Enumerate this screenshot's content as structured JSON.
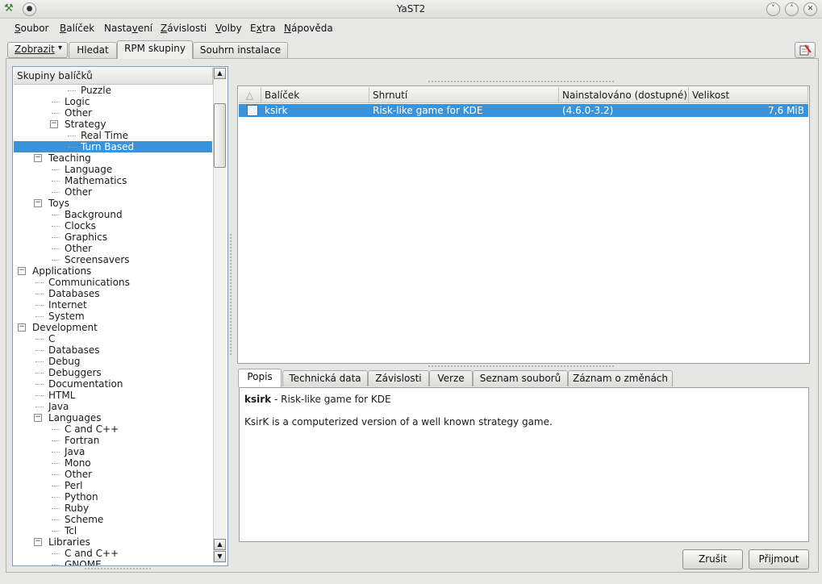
{
  "window": {
    "title": "YaST2",
    "controls": [
      "˅",
      "˄",
      "✕"
    ]
  },
  "menu": [
    {
      "pre": "",
      "u": "S",
      "post": "oubor"
    },
    {
      "pre": "",
      "u": "B",
      "post": "alíček"
    },
    {
      "pre": "Nasta",
      "u": "v",
      "post": "ení"
    },
    {
      "pre": "",
      "u": "Z",
      "post": "ávislosti"
    },
    {
      "pre": "",
      "u": "V",
      "post": "olby"
    },
    {
      "pre": "E",
      "u": "x",
      "post": "tra"
    },
    {
      "pre": "",
      "u": "N",
      "post": "ápověda"
    }
  ],
  "view_button": {
    "label": "Zobrazit",
    "arrow": "▾"
  },
  "tabs": [
    {
      "label": "Hledat"
    },
    {
      "label": "RPM skupiny"
    },
    {
      "label": "Souhrn instalace"
    }
  ],
  "tree": {
    "header": "Skupiny balíčků",
    "rows": [
      {
        "label": "Puzzle",
        "level": 4
      },
      {
        "label": "Logic",
        "level": 3
      },
      {
        "label": "Other",
        "level": 3
      },
      {
        "label": "Strategy",
        "level": 3,
        "expander": "−"
      },
      {
        "label": "Real Time",
        "level": 4
      },
      {
        "label": "Turn Based",
        "level": 4,
        "selected": true
      },
      {
        "label": "Teaching",
        "level": 2,
        "expander": "−"
      },
      {
        "label": "Language",
        "level": 3
      },
      {
        "label": "Mathematics",
        "level": 3
      },
      {
        "label": "Other",
        "level": 3
      },
      {
        "label": "Toys",
        "level": 2,
        "expander": "−"
      },
      {
        "label": "Background",
        "level": 3
      },
      {
        "label": "Clocks",
        "level": 3
      },
      {
        "label": "Graphics",
        "level": 3
      },
      {
        "label": "Other",
        "level": 3
      },
      {
        "label": "Screensavers",
        "level": 3
      },
      {
        "label": "Applications",
        "level": 1,
        "expander": "−"
      },
      {
        "label": "Communications",
        "level": 2
      },
      {
        "label": "Databases",
        "level": 2
      },
      {
        "label": "Internet",
        "level": 2
      },
      {
        "label": "System",
        "level": 2
      },
      {
        "label": "Development",
        "level": 1,
        "expander": "−"
      },
      {
        "label": "C",
        "level": 2
      },
      {
        "label": "Databases",
        "level": 2
      },
      {
        "label": "Debug",
        "level": 2
      },
      {
        "label": "Debuggers",
        "level": 2
      },
      {
        "label": "Documentation",
        "level": 2
      },
      {
        "label": "HTML",
        "level": 2
      },
      {
        "label": "Java",
        "level": 2
      },
      {
        "label": "Languages",
        "level": 2,
        "expander": "−"
      },
      {
        "label": "C and C++",
        "level": 3
      },
      {
        "label": "Fortran",
        "level": 3
      },
      {
        "label": "Java",
        "level": 3
      },
      {
        "label": "Mono",
        "level": 3
      },
      {
        "label": "Other",
        "level": 3
      },
      {
        "label": "Perl",
        "level": 3
      },
      {
        "label": "Python",
        "level": 3
      },
      {
        "label": "Ruby",
        "level": 3
      },
      {
        "label": "Scheme",
        "level": 3
      },
      {
        "label": "Tcl",
        "level": 3
      },
      {
        "label": "Libraries",
        "level": 2,
        "expander": "−"
      },
      {
        "label": "C and C++",
        "level": 3
      },
      {
        "label": "GNOME",
        "level": 3
      }
    ]
  },
  "table": {
    "sort_glyph": "△",
    "columns": [
      "Balíček",
      "Shrnutí",
      "Nainstalováno (dostupné)",
      "Velikost"
    ],
    "rows": [
      {
        "name": "ksirk",
        "summary": "Risk-like game for KDE",
        "installed": "(4.6.0-3.2)",
        "size": "7,6 MiB"
      }
    ]
  },
  "detail_tabs": [
    {
      "label": "Popis"
    },
    {
      "label": "Technická data"
    },
    {
      "label": "Závislosti"
    },
    {
      "label": "Verze"
    },
    {
      "label": "Seznam souborů"
    },
    {
      "label": "Záznam o změnách"
    }
  ],
  "description": {
    "name": "ksirk",
    "separator": " - ",
    "summary": "Risk-like game for KDE",
    "body": "KsirK is a computerized version of a well known strategy game."
  },
  "buttons": {
    "cancel": "Zrušit",
    "accept": "Přijmout"
  }
}
